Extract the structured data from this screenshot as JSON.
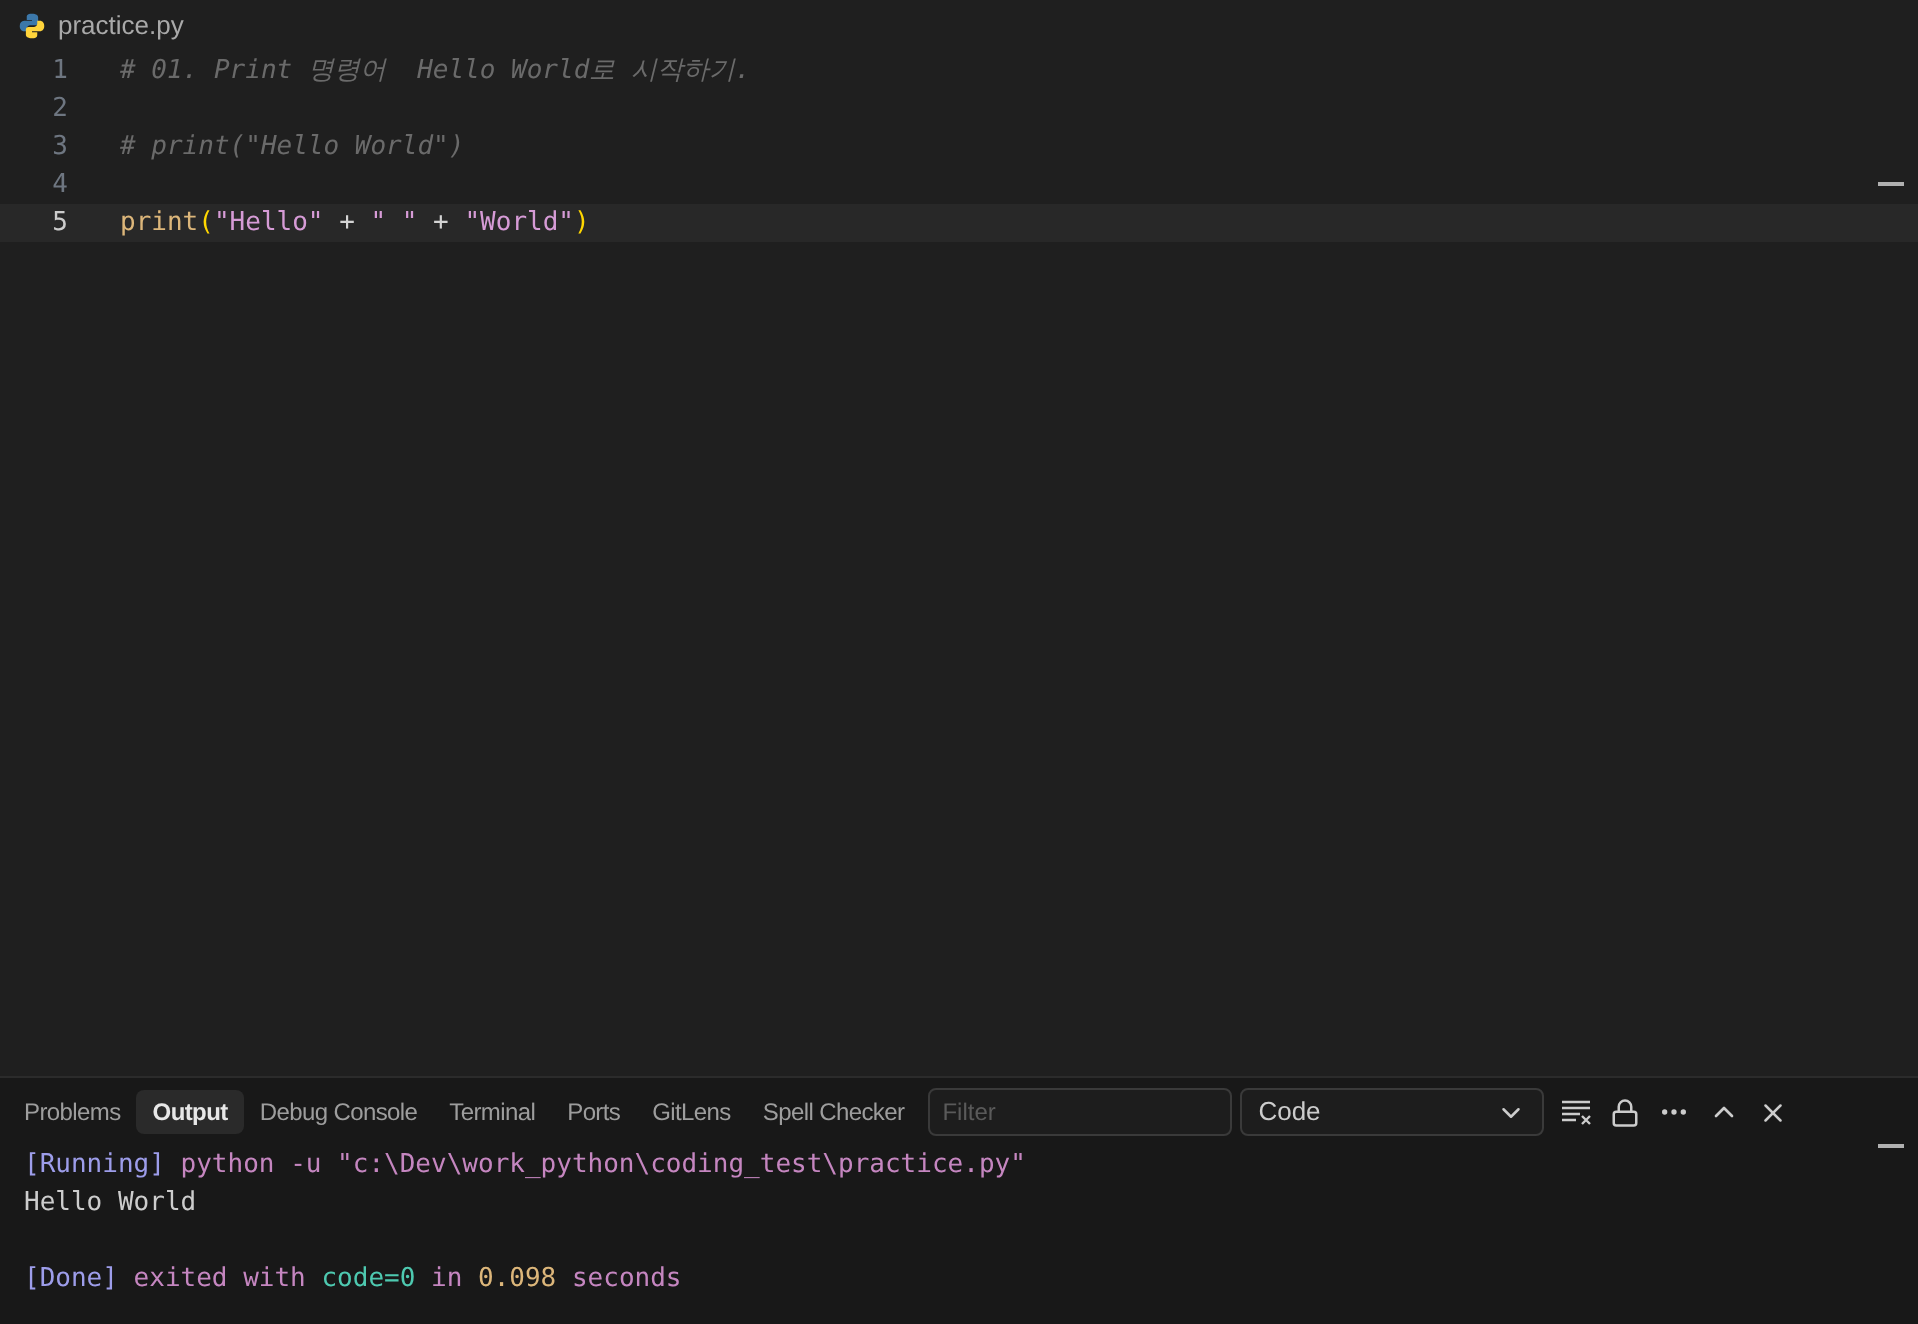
{
  "breadcrumb": {
    "file": "practice.py"
  },
  "editor": {
    "lines": [
      {
        "number": "1",
        "active": false,
        "tokens": [
          {
            "kind": "comment",
            "text": "# 01. Print 명령어  Hello World로 시작하기."
          }
        ]
      },
      {
        "number": "2",
        "active": false
      },
      {
        "number": "3",
        "active": false,
        "tokens": [
          {
            "kind": "comment",
            "text": "# print(\"Hello World\")"
          }
        ]
      },
      {
        "number": "4",
        "active": false
      },
      {
        "number": "5",
        "active": true,
        "tokens": [
          {
            "kind": "function",
            "text": "print"
          },
          {
            "kind": "bracket",
            "text": "("
          },
          {
            "kind": "string",
            "text": "\"Hello\""
          },
          {
            "kind": "plain",
            "text": " + "
          },
          {
            "kind": "string",
            "text": "\" \""
          },
          {
            "kind": "plain",
            "text": " + "
          },
          {
            "kind": "string",
            "text": "\"World\""
          },
          {
            "kind": "bracket",
            "text": ")"
          }
        ]
      }
    ]
  },
  "panel": {
    "tabs": [
      {
        "label": "Problems",
        "selected": false
      },
      {
        "label": "Output",
        "selected": true
      },
      {
        "label": "Debug Console",
        "selected": false
      },
      {
        "label": "Terminal",
        "selected": false
      },
      {
        "label": "Ports",
        "selected": false
      },
      {
        "label": "GitLens",
        "selected": false
      },
      {
        "label": "Spell Checker",
        "selected": false
      }
    ],
    "filter": {
      "placeholder": "Filter"
    },
    "channel": {
      "value": "Code"
    },
    "output": [
      {
        "gap_before": false,
        "tokens": [
          {
            "kind": "tag",
            "text": "[Running]"
          },
          {
            "kind": "text",
            "text": " python -u \"c:\\Dev\\work_python\\coding_test\\practice.py\""
          }
        ]
      },
      {
        "gap_before": false,
        "tokens": [
          {
            "kind": "plain",
            "text": "Hello World"
          }
        ]
      },
      {
        "gap_before": true,
        "tokens": [
          {
            "kind": "tag",
            "text": "[Done]"
          },
          {
            "kind": "text",
            "text": " exited with "
          },
          {
            "kind": "code",
            "text": "code=0"
          },
          {
            "kind": "text",
            "text": " in "
          },
          {
            "kind": "number",
            "text": "0.098"
          },
          {
            "kind": "text",
            "text": " seconds"
          }
        ]
      }
    ]
  }
}
